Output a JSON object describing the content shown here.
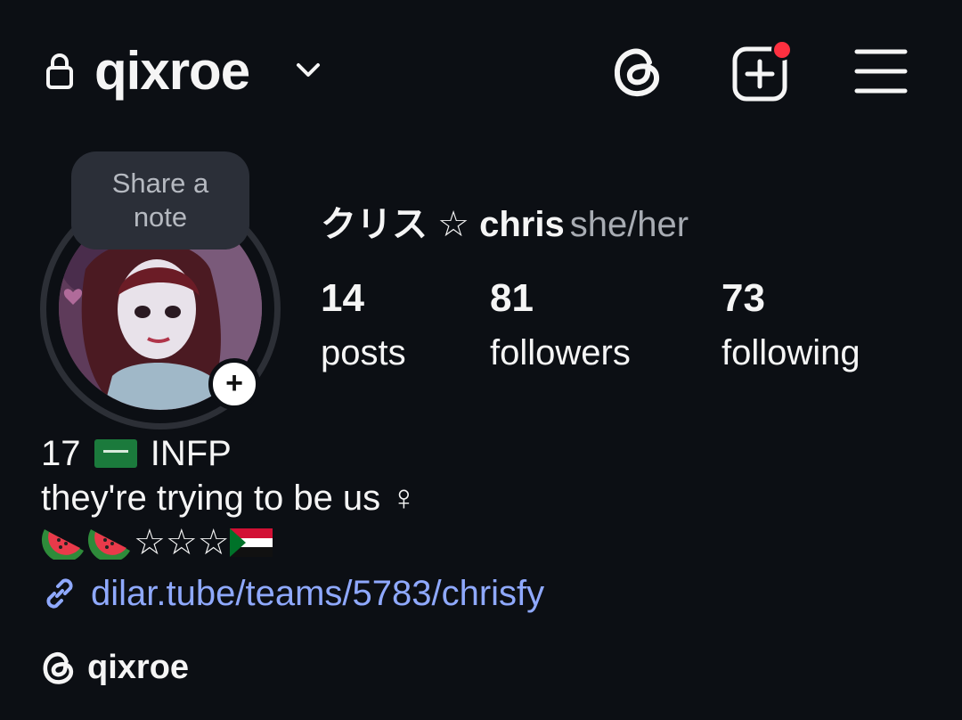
{
  "header": {
    "username": "qixroe",
    "icons": [
      "lock-icon",
      "chevron-down-icon",
      "threads-icon",
      "create-icon",
      "menu-icon"
    ]
  },
  "note": {
    "line1": "Share a",
    "line2": "note"
  },
  "profile": {
    "display_name": "クリス ☆ chris",
    "pronouns": "she/her",
    "add_story_label": "+"
  },
  "stats": {
    "posts": {
      "count": "14",
      "label": "posts"
    },
    "followers": {
      "count": "81",
      "label": "followers"
    },
    "following": {
      "count": "73",
      "label": "following"
    }
  },
  "bio": {
    "line1_pre": "17",
    "line1_post": "INFP",
    "line2": "they're trying to be us ♀",
    "line3_stars": "☆☆☆",
    "link": "dilar.tube/teams/5783/chrisfy"
  },
  "threads_badge": {
    "handle": "qixroe"
  },
  "colors": {
    "background": "#0c0f14",
    "link": "#8fa9ff",
    "notification_dot": "#ff3040",
    "note_bubble": "#2b2f38"
  }
}
